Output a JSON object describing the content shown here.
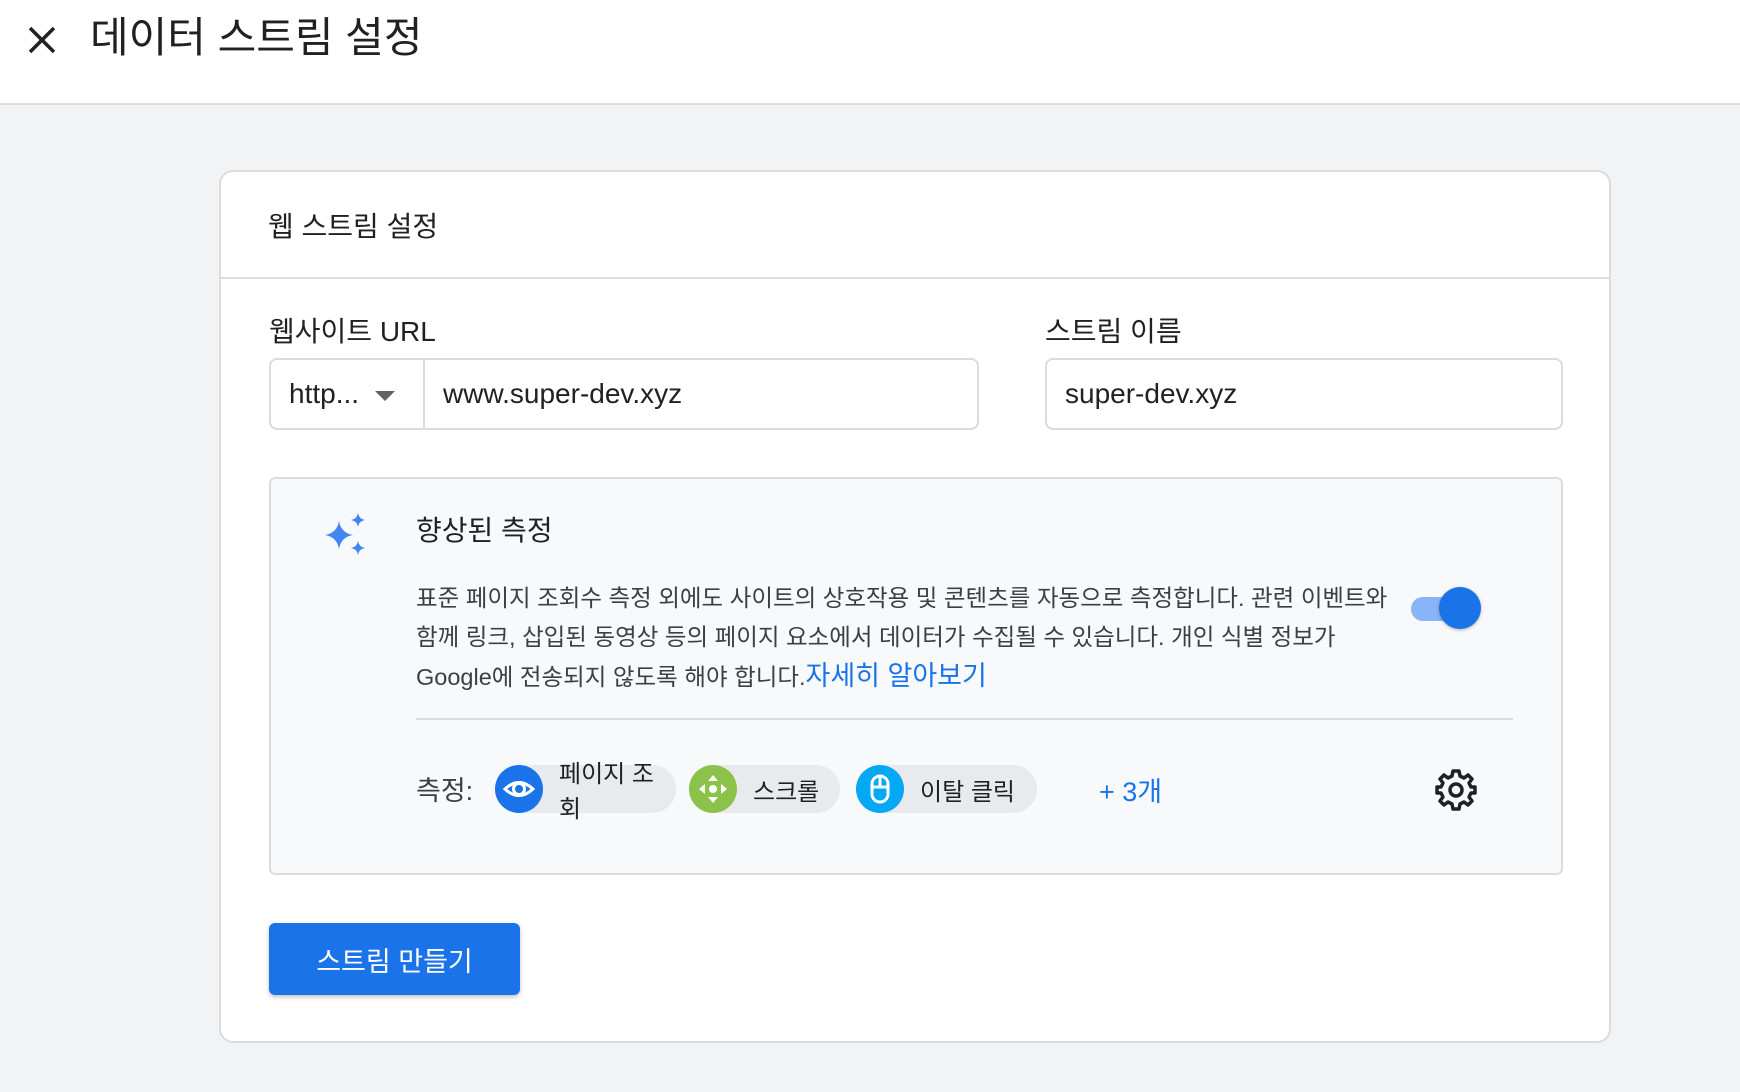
{
  "header": {
    "title": "데이터 스트림 설정",
    "close_icon": "close-icon"
  },
  "card": {
    "title": "웹 스트림 설정",
    "website_url": {
      "label": "웹사이트 URL",
      "protocol": "http...",
      "value": "www.super-dev.xyz"
    },
    "stream_name": {
      "label": "스트림 이름",
      "value": "super-dev.xyz"
    },
    "enhanced_measurement": {
      "icon": "sparkle-icon",
      "title": "향상된 측정",
      "description": "표준 페이지 조회수 측정 외에도 사이트의 상호작용 및 콘텐츠를 자동으로 측정합니다. 관련 이벤트와 함께 링크, 삽입된 동영상 등의 페이지 요소에서 데이터가 수집될 수 있습니다. 개인 식별 정보가 Google에 전송되지 않도록 해야 합니다.",
      "learn_more": "자세히 알아보기",
      "enabled": true,
      "metrics_label": "측정:",
      "metrics": [
        {
          "label": "페이지 조회",
          "icon": "eye-icon",
          "color": "#1a73e8"
        },
        {
          "label": "스크롤",
          "icon": "scroll-arrows-icon",
          "color": "#8bc34a"
        },
        {
          "label": "이탈 클릭",
          "icon": "mouse-icon",
          "color": "#03a9f4"
        }
      ],
      "more": "+ 3개",
      "settings_icon": "gear-icon"
    },
    "create_button": "스트림 만들기"
  },
  "colors": {
    "accent": "#1a73e8",
    "toggle_track": "#8ab4f8",
    "background": "#f1f3f4"
  }
}
